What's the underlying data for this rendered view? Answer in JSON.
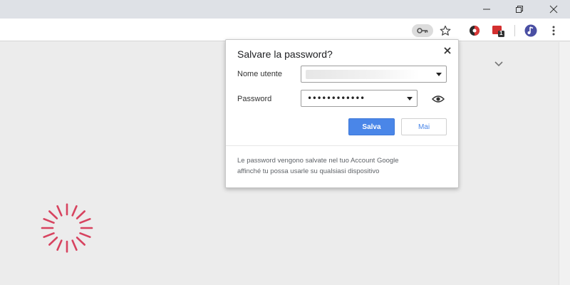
{
  "window": {
    "minimize_icon": "minimize-icon",
    "restore_icon": "restore-icon",
    "close_icon": "close-icon"
  },
  "toolbar": {
    "icons": [
      "key-icon",
      "star-icon",
      "extension-icon",
      "extension-badge-icon",
      "profile-icon",
      "menu-icon"
    ],
    "extension_badge_count": "1"
  },
  "popup": {
    "title": "Salvare la password?",
    "username_label": "Nome utente",
    "password_label": "Password",
    "password_value": "••••••••••••",
    "save_label": "Salva",
    "never_label": "Mai",
    "footer_line1": "Le password vengono salvate nel tuo Account Google",
    "footer_line2": "affinché tu possa usarle su qualsiasi dispositivo"
  },
  "colors": {
    "accent": "#4a86e8",
    "spinner": "#d7435f"
  }
}
